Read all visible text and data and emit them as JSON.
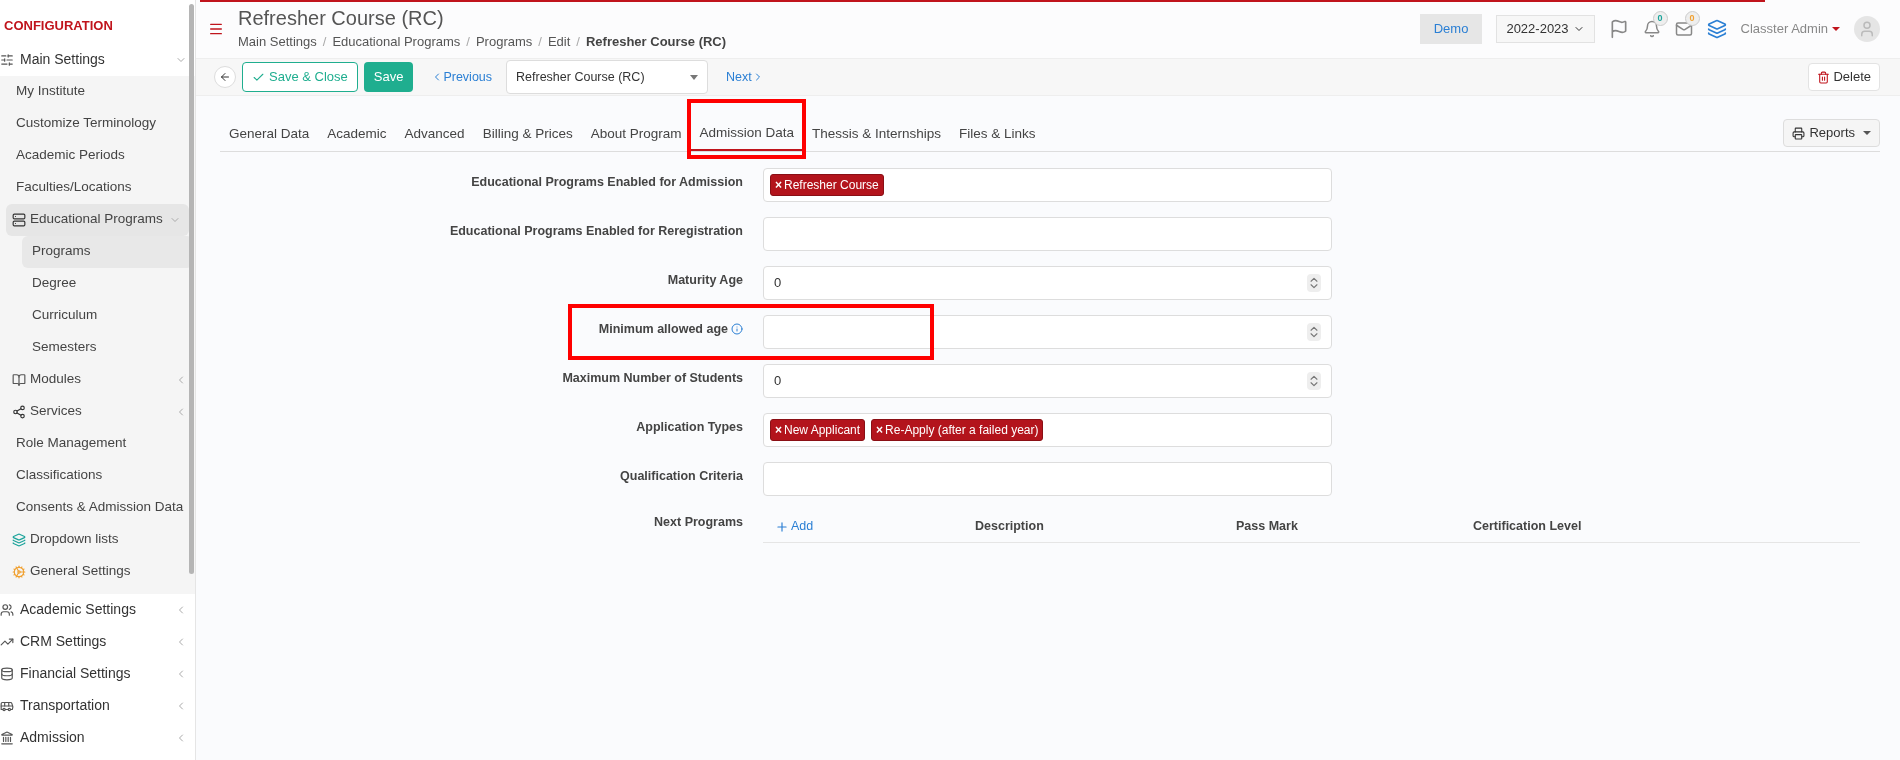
{
  "sidebar": {
    "heading": "CONFIGURATION",
    "items": [
      {
        "label": "Main Settings",
        "expanded": true,
        "children": [
          {
            "label": "My Institute",
            "selected": false
          },
          {
            "label": "Customize Terminology",
            "selected": false
          },
          {
            "label": "Academic Periods",
            "selected": false
          },
          {
            "label": "Faculties/Locations",
            "selected": false
          },
          {
            "label": "Educational Programs",
            "selected": true,
            "expanded": true,
            "children": [
              {
                "label": "Programs",
                "selected": true
              },
              {
                "label": "Degree",
                "selected": false
              },
              {
                "label": "Curriculum",
                "selected": false
              },
              {
                "label": "Semesters",
                "selected": false
              }
            ]
          },
          {
            "label": "Modules",
            "selected": false,
            "expanded": false
          },
          {
            "label": "Services",
            "selected": false,
            "expanded": false
          },
          {
            "label": "Role Management",
            "selected": false
          },
          {
            "label": "Classifications",
            "selected": false
          },
          {
            "label": "Consents & Admission Data",
            "selected": false
          },
          {
            "label": "Dropdown lists",
            "selected": false
          },
          {
            "label": "General Settings",
            "selected": false
          }
        ]
      },
      {
        "label": "Academic Settings",
        "expanded": false
      },
      {
        "label": "CRM Settings",
        "expanded": false
      },
      {
        "label": "Financial Settings",
        "expanded": false
      },
      {
        "label": "Transportation",
        "expanded": false
      },
      {
        "label": "Admission",
        "expanded": false
      }
    ]
  },
  "tag_remove": "×",
  "header": {
    "title": "Refresher Course (RC)",
    "separator": "/",
    "breadcrumb": [
      "Main Settings",
      "Educational Programs",
      "Programs",
      "Edit",
      "Refresher Course (RC)"
    ],
    "demo": "Demo",
    "year": "2022-2023",
    "notifications": "0",
    "messages": "0",
    "user": "Classter Admin"
  },
  "toolbar": {
    "save_close": "Save & Close",
    "save": "Save",
    "previous": "Previous",
    "record": "Refresher Course (RC)",
    "next": "Next",
    "delete": "Delete"
  },
  "tabs": [
    {
      "label": "General Data",
      "selected": false,
      "highlighted": false
    },
    {
      "label": "Academic",
      "selected": false,
      "highlighted": false
    },
    {
      "label": "Advanced",
      "selected": false,
      "highlighted": false
    },
    {
      "label": "Billing & Prices",
      "selected": false,
      "highlighted": false
    },
    {
      "label": "About Program",
      "selected": false,
      "highlighted": false
    },
    {
      "label": "Admission Data",
      "selected": true,
      "highlighted": true
    },
    {
      "label": "Thessis & Internships",
      "selected": false,
      "highlighted": false
    },
    {
      "label": "Files & Links",
      "selected": false,
      "highlighted": false
    }
  ],
  "reports": "Reports",
  "fields": [
    {
      "kind": "tags",
      "label": "Educational Programs Enabled for Admission",
      "tags": [
        "Refresher Course"
      ]
    },
    {
      "kind": "text",
      "label": "Educational Programs Enabled for Reregistration"
    },
    {
      "kind": "number",
      "label": "Maturity Age",
      "value": "0"
    },
    {
      "kind": "number",
      "label": "Minimum allowed age",
      "info": true,
      "highlighted": true
    },
    {
      "kind": "number",
      "label": "Maximum Number of Students",
      "value": "0"
    },
    {
      "kind": "tags",
      "label": "Application Types",
      "tags": [
        "New Applicant",
        "Re-Apply (after a failed year)"
      ]
    },
    {
      "kind": "text",
      "label": "Qualification Criteria"
    }
  ],
  "next_programs": {
    "label": "Next Programs",
    "add": "Add",
    "columns": [
      "Description",
      "Pass Mark",
      "Certification Level"
    ]
  }
}
